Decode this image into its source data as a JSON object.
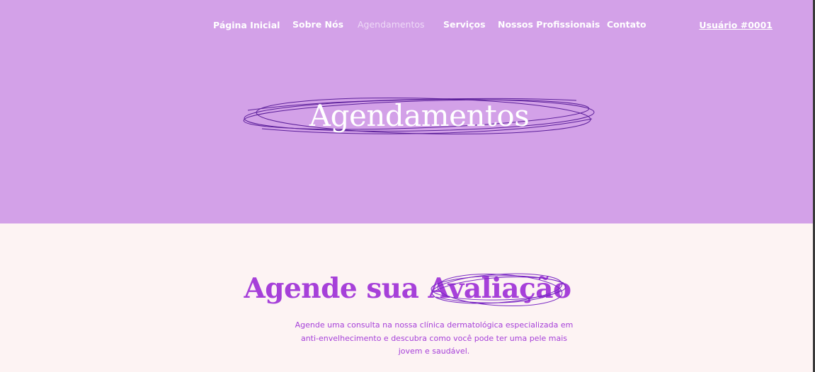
{
  "nav": {
    "items": [
      {
        "label": "Página Inicial"
      },
      {
        "label": "Sobre Nós"
      },
      {
        "label": "Agendamentos"
      },
      {
        "label": "Serviços"
      },
      {
        "label": "Nossos Profissionais"
      },
      {
        "label": "Contato"
      }
    ],
    "active_item": "Agendamentos",
    "user_link": "Usuário #0001"
  },
  "hero": {
    "title": "Agendamentos",
    "background_color": "#d3a1e8",
    "scribble_color": "#5b1f9a"
  },
  "booking": {
    "title": "Agende sua Avaliação",
    "description": "Agende uma consulta na nossa clínica dermatológica especializada em anti-envelhecimento e descubra como você pode ter uma pele mais jovem e saudável.",
    "accent_color": "#a640d9",
    "background_color": "#fdf3f3"
  }
}
